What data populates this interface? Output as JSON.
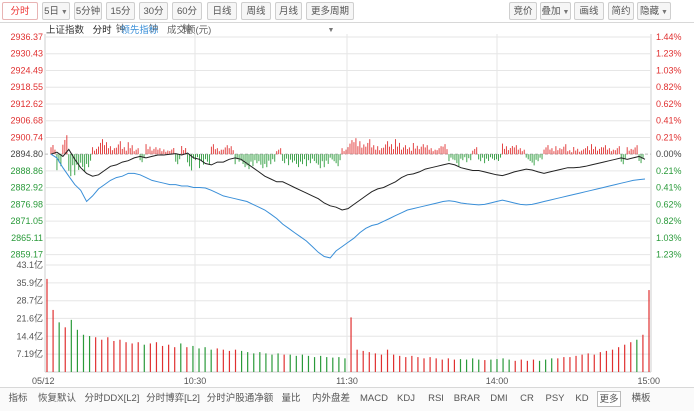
{
  "top_tabs": [
    {
      "label": "分时",
      "active": true,
      "caret": false
    },
    {
      "label": "5日",
      "caret": true
    },
    {
      "label": "5分钟",
      "caret": false
    },
    {
      "label": "15分钟",
      "caret": false
    },
    {
      "label": "30分钟",
      "caret": false
    },
    {
      "label": "60分钟",
      "caret": false
    },
    {
      "label": "日线",
      "caret": false
    },
    {
      "label": "周线",
      "caret": false
    },
    {
      "label": "月线",
      "caret": false
    },
    {
      "label": "更多周期",
      "caret": true
    }
  ],
  "right_tabs": [
    {
      "label": "竞价",
      "caret": false
    },
    {
      "label": "叠加",
      "caret": true
    },
    {
      "label": "画线",
      "caret": false
    },
    {
      "label": "简约",
      "caret": false
    },
    {
      "label": "隐藏",
      "caret": true
    }
  ],
  "legend": {
    "index_name": "上证指数",
    "series_time": "分时",
    "series_lead": "领先指标",
    "series_volume": "成交额(元)"
  },
  "bottom_tabs": [
    {
      "label": "指标",
      "sel": false
    },
    {
      "label": "恢复默认",
      "sel": false
    },
    {
      "label": "分时DDX[L2]",
      "sel": false
    },
    {
      "label": "分时博弈[L2]",
      "sel": false
    },
    {
      "label": "分时沪股通净额",
      "sel": false
    },
    {
      "label": "量比",
      "sel": false
    },
    {
      "label": "内外盘差",
      "sel": false
    },
    {
      "label": "MACD",
      "sel": false
    },
    {
      "label": "KDJ",
      "sel": false
    },
    {
      "label": "RSI",
      "sel": false
    },
    {
      "label": "BRAR",
      "sel": false
    },
    {
      "label": "DMI",
      "sel": false
    },
    {
      "label": "CR",
      "sel": false
    },
    {
      "label": "PSY",
      "sel": false
    },
    {
      "label": "KD",
      "sel": false
    },
    {
      "label": "更多",
      "sel": true
    },
    {
      "label": "横板",
      "sel": false
    }
  ],
  "colors": {
    "up": "#e03030",
    "down": "#2a9a3a",
    "price_line": "#222222",
    "lead_line": "#3a8fd8",
    "grid": "#e6e6e6"
  },
  "chart_data": [
    {
      "type": "line",
      "x_labels": [
        "05/12",
        "10:30",
        "11:30",
        "14:00",
        "15:00"
      ],
      "y_left_ticks": [
        "2936.37",
        "2930.43",
        "2924.49",
        "2918.55",
        "2912.62",
        "2906.68",
        "2900.74",
        "2894.80",
        "2888.86",
        "2882.92",
        "2876.98",
        "2871.05",
        "2865.11",
        "2859.17"
      ],
      "y_right_ticks": [
        "1.44%",
        "1.23%",
        "1.03%",
        "0.82%",
        "0.62%",
        "0.41%",
        "0.21%",
        "0.00%",
        "0.21%",
        "0.41%",
        "0.62%",
        "0.82%",
        "1.03%",
        "1.23%"
      ],
      "ylim": [
        2856.2,
        2936.37
      ],
      "preclose": 2894.8,
      "series": [
        {
          "values": [
            2894.8,
            2895.5,
            2894.0,
            2896.5,
            2893.0,
            2890.0,
            2888.0,
            2887.0,
            2887.5,
            2889.0,
            2890.5,
            2891.0,
            2892.0,
            2892.5,
            2893.5,
            2894.0,
            2893.5,
            2894.0,
            2894.5,
            2894.5,
            2894.8,
            2895.0,
            2894.5,
            2895.2,
            2893.5,
            2893.0,
            2891.5,
            2891.0,
            2892.0,
            2892.0,
            2893.0,
            2893.5,
            2893.0,
            2891.5,
            2890.0,
            2888.5,
            2887.0,
            2886.0,
            2885.0,
            2885.0,
            2884.0,
            2883.0,
            2882.0,
            2881.0,
            2880.0,
            2879.0,
            2877.5,
            2876.5,
            2876.0,
            2875.0,
            2875.5,
            2877.0,
            2878.5,
            2880.0,
            2881.5,
            2882.5,
            2883.0,
            2884.0,
            2885.0,
            2886.5,
            2887.5,
            2887.8,
            2888.5,
            2889.5,
            2890.0,
            2890.5,
            2891.0,
            2891.5,
            2891.0,
            2890.0,
            2889.5,
            2889.0,
            2889.0,
            2888.5,
            2888.0,
            2887.5,
            2887.2,
            2887.8,
            2888.5,
            2889.0,
            2889.5,
            2889.2,
            2888.5,
            2888.0,
            2888.5,
            2889.0,
            2889.5,
            2890.0,
            2890.0,
            2890.2,
            2890.5,
            2891.0,
            2891.5,
            2892.0,
            2892.5,
            2893.0,
            2893.5,
            2893.0,
            2893.5,
            2894.0,
            2893.0
          ]
        },
        {
          "values": [
            2894.8,
            2893.5,
            2890.0,
            2887.0,
            2884.0,
            2882.0,
            2878.0,
            2880.0,
            2882.5,
            2884.0,
            2885.5,
            2886.5,
            2887.0,
            2888.0,
            2888.0,
            2887.5,
            2886.5,
            2885.5,
            2885.0,
            2884.5,
            2884.0,
            2884.0,
            2883.5,
            2883.5,
            2883.0,
            2883.0,
            2882.8,
            2882.0,
            2881.0,
            2880.0,
            2879.5,
            2879.0,
            2878.5,
            2878.0,
            2877.0,
            2876.0,
            2875.0,
            2873.5,
            2872.0,
            2870.0,
            2868.5,
            2867.0,
            2865.5,
            2864.0,
            2862.0,
            2860.0,
            2858.5,
            2858.0,
            2860.5,
            2862.0,
            2863.5,
            2865.0,
            2867.0,
            2868.5,
            2869.5,
            2870.0,
            2871.0,
            2872.0,
            2873.0,
            2874.0,
            2875.0,
            2875.5,
            2876.0,
            2876.5,
            2877.0,
            2877.5,
            2878.0,
            2878.3,
            2878.0,
            2877.5,
            2877.2,
            2877.0,
            2876.8,
            2877.0,
            2877.5,
            2878.0,
            2878.5,
            2878.0,
            2877.5,
            2877.0,
            2876.8,
            2877.0,
            2877.5,
            2878.0,
            2878.5,
            2879.0,
            2879.5,
            2880.0,
            2880.5,
            2881.0,
            2881.5,
            2882.0,
            2882.5,
            2883.0,
            2883.5,
            2884.0,
            2884.5,
            2885.0,
            2885.5,
            2885.8,
            2886.0
          ]
        }
      ]
    },
    {
      "type": "bar",
      "y_ticks": [
        "43.1亿",
        "35.9亿",
        "28.7亿",
        "21.6亿",
        "14.4亿",
        "7.19亿"
      ],
      "ylim": [
        0,
        43.1
      ],
      "values": [
        37.5,
        25.0,
        20.0,
        18.0,
        21.0,
        17.0,
        15.0,
        14.5,
        14.0,
        13.0,
        14.0,
        12.5,
        13.0,
        12.0,
        11.5,
        12.0,
        11.0,
        11.5,
        12.0,
        10.5,
        11.0,
        10.0,
        11.5,
        10.0,
        10.5,
        9.5,
        10.0,
        9.0,
        9.5,
        9.0,
        8.5,
        9.0,
        8.5,
        8.0,
        7.5,
        8.0,
        7.5,
        7.0,
        7.5,
        7.0,
        7.0,
        6.5,
        7.0,
        6.5,
        6.0,
        6.5,
        6.0,
        5.8,
        6.0,
        5.5,
        22.0,
        9.0,
        8.5,
        8.0,
        7.5,
        7.0,
        9.0,
        7.0,
        6.5,
        6.0,
        6.5,
        6.0,
        5.5,
        6.0,
        5.5,
        5.0,
        5.5,
        5.0,
        5.2,
        5.0,
        5.5,
        5.0,
        4.8,
        5.0,
        5.2,
        5.5,
        5.0,
        4.5,
        5.0,
        4.5,
        5.0,
        4.5,
        5.0,
        5.5,
        5.5,
        6.0,
        6.0,
        6.5,
        7.0,
        7.5,
        7.0,
        8.0,
        8.5,
        9.0,
        10.0,
        11.0,
        12.0,
        13.0,
        15.0,
        33.0
      ]
    }
  ]
}
